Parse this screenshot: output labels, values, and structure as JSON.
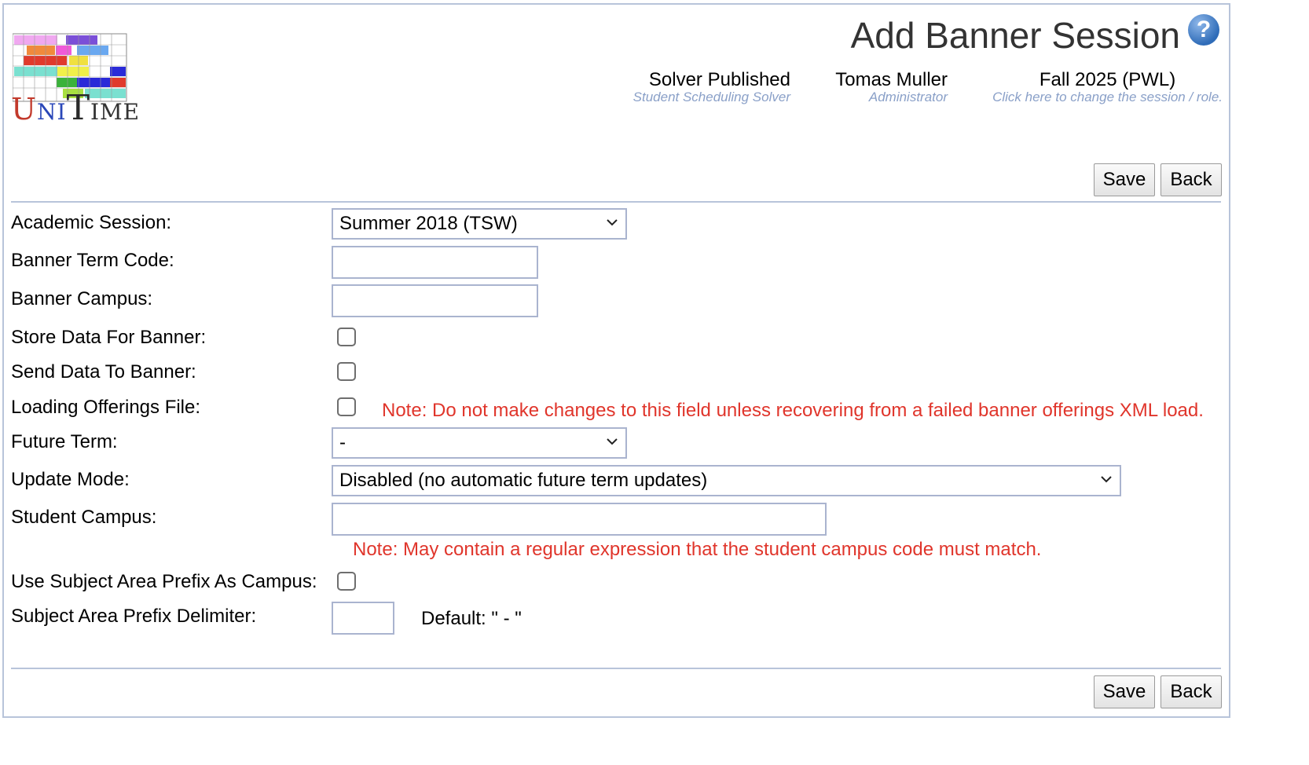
{
  "header": {
    "title": "Add Banner Session",
    "solver": {
      "main": "Solver Published",
      "sub": "Student Scheduling Solver"
    },
    "user": {
      "main": "Tomas Muller",
      "sub": "Administrator"
    },
    "session": {
      "main": "Fall 2025 (PWL)",
      "sub": "Click here to change the session / role."
    }
  },
  "logo": {
    "u": "U",
    "ni": "NI",
    "t": "T",
    "ime": "IME"
  },
  "buttons": {
    "save": "Save",
    "back": "Back"
  },
  "form": {
    "academic_session": {
      "label": "Academic Session:",
      "value": "Summer 2018 (TSW)"
    },
    "banner_term_code": {
      "label": "Banner Term Code:",
      "value": ""
    },
    "banner_campus": {
      "label": "Banner Campus:",
      "value": ""
    },
    "store_data": {
      "label": "Store Data For Banner:",
      "checked": false
    },
    "send_data": {
      "label": "Send Data To Banner:",
      "checked": false
    },
    "loading_offerings": {
      "label": "Loading Offerings File:",
      "checked": false,
      "note": "Note: Do not make changes to this field unless recovering from a failed banner offerings XML load."
    },
    "future_term": {
      "label": "Future Term:",
      "value": "-"
    },
    "update_mode": {
      "label": "Update Mode:",
      "value": "Disabled (no automatic future term updates)"
    },
    "student_campus": {
      "label": "Student Campus:",
      "value": "",
      "note": "Note: May contain a regular expression that the student campus code must match."
    },
    "use_subject_prefix": {
      "label": "Use Subject Area Prefix As Campus:",
      "checked": false
    },
    "subject_prefix_delimiter": {
      "label": "Subject Area Prefix Delimiter:",
      "value": "",
      "default": "Default: \" - \""
    }
  },
  "colors": {
    "border": "#b8c4da",
    "note": "#e0352b",
    "sub_text": "#8aa0c8"
  }
}
